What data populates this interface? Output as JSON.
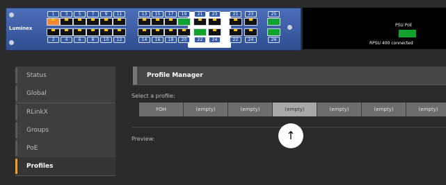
{
  "device": {
    "brand": "Luminex",
    "ports_top": [
      "1",
      "3",
      "5",
      "7",
      "9",
      "11",
      "13",
      "15",
      "17",
      "19",
      "21",
      "23"
    ],
    "ports_bottom": [
      "2",
      "4",
      "6",
      "8",
      "10",
      "12",
      "14",
      "16",
      "18",
      "20",
      "22",
      "24"
    ],
    "sfp_top": [
      "21",
      "23"
    ],
    "sfp_bottom": [
      "22",
      "24"
    ],
    "uplink_top": "25",
    "uplink_bottom": "26",
    "display": {
      "psu_label": "PSU PoE",
      "status_text": "RPSU 400 connected"
    }
  },
  "sidebar": {
    "items": [
      {
        "label": "Status"
      },
      {
        "label": "Global"
      },
      {
        "label": "RLinkX"
      },
      {
        "label": "Groups"
      },
      {
        "label": "PoE"
      },
      {
        "label": "Profiles"
      }
    ],
    "active": "Profiles"
  },
  "main": {
    "header": "Profile Manager",
    "select_label": "Select a profile:",
    "profiles": [
      "FOH",
      "(empty)",
      "(empty)",
      "(empty)",
      "(empty)",
      "(empty)",
      "(empty)"
    ],
    "selected_profile_index": 3,
    "preview_label": "Preview:"
  },
  "overlay": {
    "icon": "arrow-up-icon",
    "glyph": "↑"
  },
  "colors": {
    "accent": "#f2a21a",
    "panel_blue": "#3a5ba3",
    "port_green": "#11a330",
    "port_orange": "#f08a3a"
  }
}
